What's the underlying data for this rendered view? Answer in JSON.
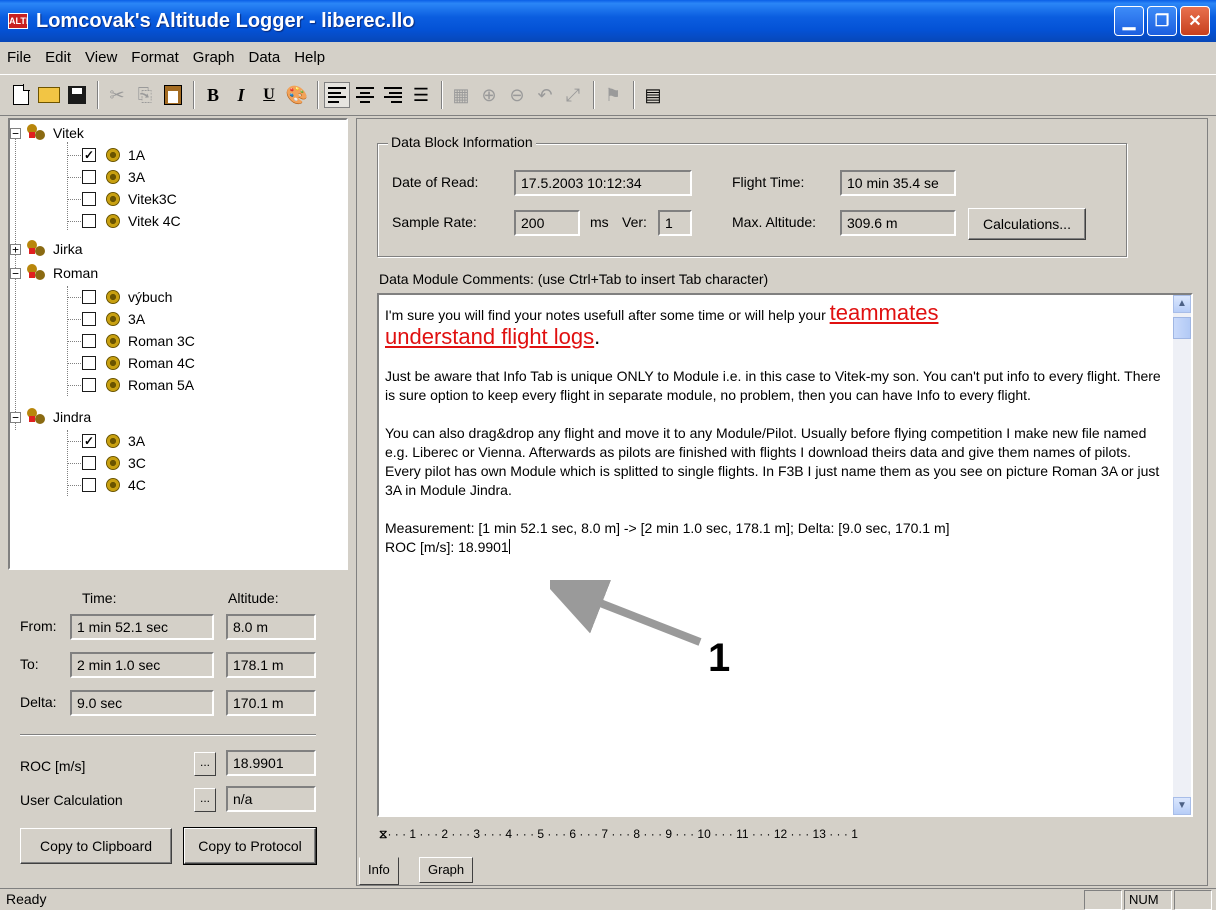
{
  "window": {
    "icon_text": "ALTI",
    "title": "Lomcovak's Altitude Logger - liberec.llo"
  },
  "menu": [
    "File",
    "Edit",
    "View",
    "Format",
    "Graph",
    "Data",
    "Help"
  ],
  "toolbar": {
    "icons": [
      "new-file-icon",
      "open-folder-icon",
      "save-icon",
      "cut-icon",
      "copy-icon",
      "paste-icon",
      "bold-icon",
      "italic-icon",
      "underline-icon",
      "color-icon",
      "align-left-icon",
      "align-center-icon",
      "align-right-icon",
      "bullets-icon",
      "graph-icon",
      "zoom-in-icon",
      "zoom-out-icon",
      "zoom-back-icon",
      "zoom-fit-icon",
      "marker-icon",
      "properties-icon"
    ],
    "bold": "B",
    "italic": "I",
    "underline": "U"
  },
  "tree": {
    "pilots": [
      {
        "name": "Vitek",
        "expanded": true,
        "flights": [
          {
            "name": "1A",
            "checked": true
          },
          {
            "name": "3A",
            "checked": false
          },
          {
            "name": "Vitek3C",
            "checked": false
          },
          {
            "name": "Vitek 4C",
            "checked": false
          }
        ]
      },
      {
        "name": "Jirka",
        "expanded": false,
        "flights": []
      },
      {
        "name": "Roman",
        "expanded": true,
        "flights": [
          {
            "name": "výbuch",
            "checked": false
          },
          {
            "name": "3A",
            "checked": false
          },
          {
            "name": "Roman 3C",
            "checked": false
          },
          {
            "name": "Roman 4C",
            "checked": false
          },
          {
            "name": "Roman 5A",
            "checked": false
          }
        ]
      },
      {
        "name": "Jindra",
        "expanded": true,
        "flights": [
          {
            "name": "3A",
            "checked": true
          },
          {
            "name": "3C",
            "checked": false
          },
          {
            "name": "4C",
            "checked": false
          }
        ]
      }
    ]
  },
  "measure": {
    "time_header": "Time:",
    "altitude_header": "Altitude:",
    "from_label": "From:",
    "from_time": "1 min 52.1 sec",
    "from_alt": "8.0 m",
    "to_label": "To:",
    "to_time": "2 min 1.0 sec",
    "to_alt": "178.1 m",
    "delta_label": "Delta:",
    "delta_time": "9.0 sec",
    "delta_alt": "170.1 m",
    "roc_label": "ROC [m/s]",
    "roc_value": "18.9901",
    "user_label": "User  Calculation",
    "user_value": "n/a",
    "ellipsis": "...",
    "copy_clipboard": "Copy to Clipboard",
    "copy_protocol": "Copy to Protocol"
  },
  "info": {
    "group_title": "Data Block Information",
    "date_label": "Date of Read:",
    "date_value": "17.5.2003 10:12:34",
    "flight_time_label": "Flight Time:",
    "flight_time_value": "10 min 35.4 se",
    "sample_rate_label": "Sample Rate:",
    "sample_rate_value": "200",
    "ms_label": "ms",
    "ver_label": "Ver:",
    "ver_value": "1",
    "max_alt_label": "Max. Altitude:",
    "max_alt_value": "309.6 m",
    "calc_button": "Calculations..."
  },
  "comments": {
    "label": "Data Module Comments: (use Ctrl+Tab to insert Tab character)",
    "p1_text": "I'm sure you will find your notes usefull after some time or will help your ",
    "p1_link1": "teammates ",
    "p1_link2": "understand flight logs",
    "p1_end": ".",
    "p2": "Just be aware that Info Tab is unique ONLY to Module i.e. in this case to Vitek-my son. You can't put info to every flight. There is sure option to keep every flight in separate module, no problem, then you can have Info to every flight.",
    "p3": "You can also drag&drop any flight and move it to any Module/Pilot. Usually before flying competition I make new file named e.g. Liberec or Vienna. Afterwards as pilots are finished with flights I download theirs data and give them names of pilots. Every pilot has own Module which is splitted to single flights. In F3B I just name them as you see on picture Roman 3A or just 3A in Module Jindra.",
    "p4_line1": "Measurement: [1 min 52.1 sec, 8.0 m] -> [2 min 1.0 sec, 178.1 m]; Delta: [9.0 sec, 170.1 m]",
    "p4_line2": "ROC [m/s]: 18.9901",
    "link_color": "#e01010"
  },
  "ruler": {
    "text": "· · · 1 · · · 2 · · · 3 · · · 4 · · · 5 · · · 6 · · · 7 · · · 8 · · · 9 · · · 10 · · · 11 · · · 12 · · · 13 · · · 1"
  },
  "tabs": [
    "Info",
    "Graph"
  ],
  "annotation": {
    "number": "1"
  },
  "status": {
    "text": "Ready",
    "num": "NUM"
  }
}
